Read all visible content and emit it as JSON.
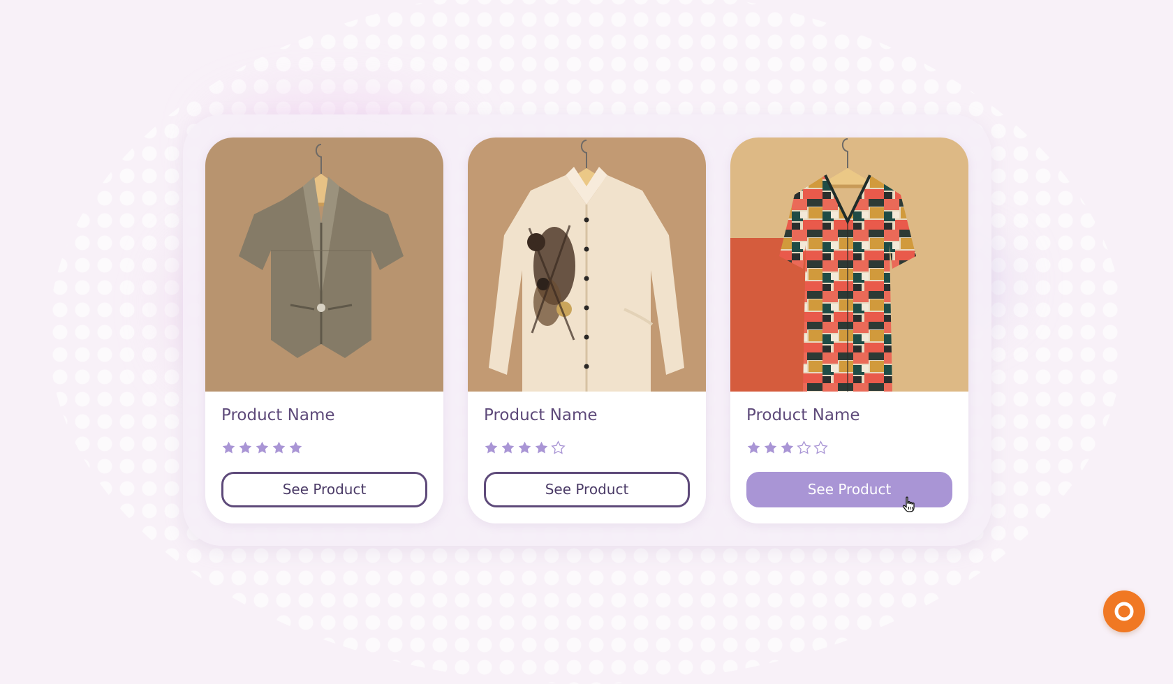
{
  "products": [
    {
      "name": "Product Name",
      "image": "cropped-jacket-image",
      "rating": 5,
      "max_rating": 5,
      "button_label": "See Product"
    },
    {
      "name": "Product Name",
      "image": "floral-print-shirt-image",
      "rating": 4,
      "max_rating": 5,
      "button_label": "See Product"
    },
    {
      "name": "Product Name",
      "image": "patterned-blouse-image",
      "rating": 3,
      "max_rating": 5,
      "button_label": "See Product",
      "button_state": "hover"
    }
  ],
  "colors": {
    "page_background": "#f8f1f8",
    "text": "#5e4a7a",
    "star_filled": "#a995d5",
    "button_hover": "#a995d5",
    "help_button": "#f07823"
  },
  "icons": {
    "cursor": "hand-pointer-icon",
    "help": "help-ring-icon"
  }
}
